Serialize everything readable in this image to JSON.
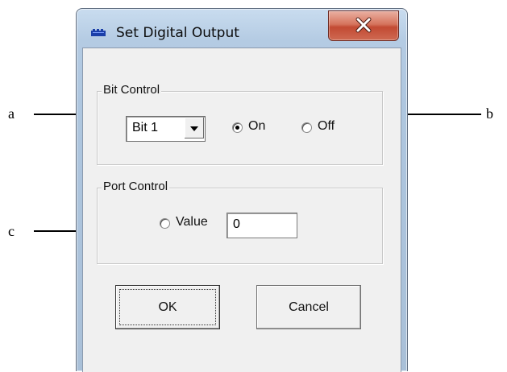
{
  "window": {
    "title": "Set Digital Output",
    "close_glyph": "x"
  },
  "bit_control": {
    "label": "Bit Control",
    "combo_value": "Bit 1",
    "radio_on": {
      "label": "On",
      "selected": true
    },
    "radio_off": {
      "label": "Off",
      "selected": false
    }
  },
  "port_control": {
    "label": "Port Control",
    "radio_value": {
      "label": "Value",
      "selected": false
    },
    "value": "0"
  },
  "buttons": {
    "ok": "OK",
    "cancel": "Cancel"
  },
  "annotations": {
    "a": "a",
    "b": "b",
    "c": "c"
  },
  "icons": {
    "app": "app-icon",
    "close": "close-icon",
    "dropdown": "chevron-down-icon",
    "arrows": "arrow-right-icon"
  },
  "colors": {
    "frame": "#aec6df",
    "close_button": "#c9523a",
    "client": "#f0f0f0"
  }
}
